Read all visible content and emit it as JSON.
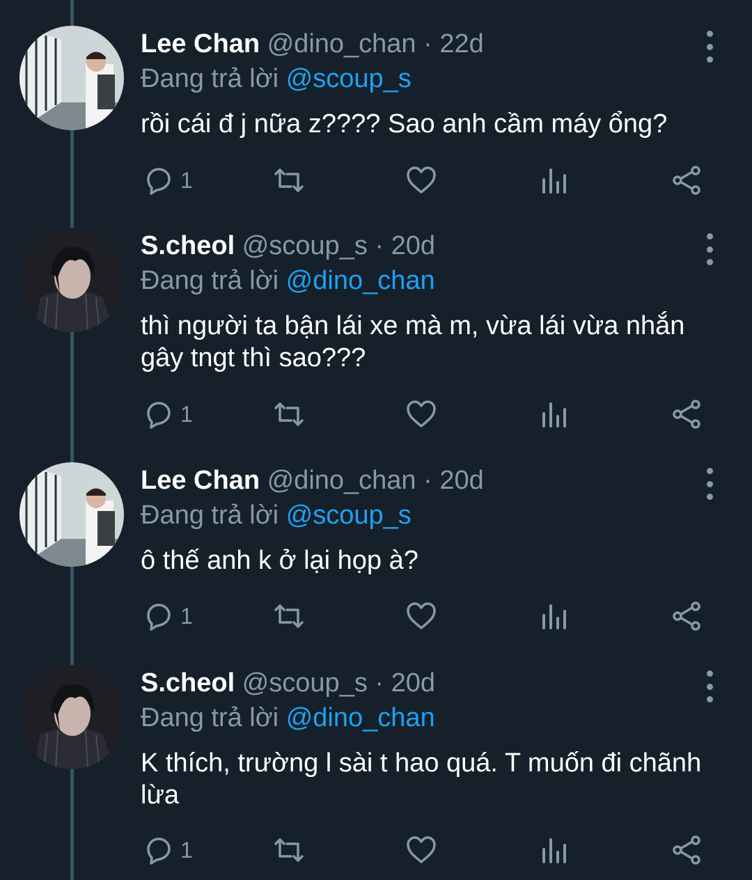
{
  "colors": {
    "background": "#15202b",
    "secondary_text": "#8899a6",
    "mention": "#1da1f2",
    "thread_line": "#3d5466"
  },
  "tweets": [
    {
      "name": "Lee Chan",
      "handle": "@dino_chan",
      "dot": "·",
      "time": "22d",
      "reply_prefix": "Đang trả lời ",
      "reply_to": "@scoup_s",
      "text": "rồi cái đ j nữa z???? Sao anh cầm máy ổng?",
      "reply_count": "1",
      "avatar": "lee-chan-avatar"
    },
    {
      "name": "S.cheol",
      "handle": "@scoup_s",
      "dot": "·",
      "time": "20d",
      "reply_prefix": "Đang trả lời ",
      "reply_to": "@dino_chan",
      "text": "thì người ta bận lái xe mà m, vừa lái vừa nhắn gây tngt thì sao???",
      "reply_count": "1",
      "avatar": "scheol-avatar"
    },
    {
      "name": "Lee Chan",
      "handle": "@dino_chan",
      "dot": "·",
      "time": "20d",
      "reply_prefix": "Đang trả lời ",
      "reply_to": "@scoup_s",
      "text": "ô thế anh k ở lại họp à?",
      "reply_count": "1",
      "avatar": "lee-chan-avatar"
    },
    {
      "name": "S.cheol",
      "handle": "@scoup_s",
      "dot": "·",
      "time": "20d",
      "reply_prefix": "Đang trả lời ",
      "reply_to": "@dino_chan",
      "text": "K thích, trường l sài t hao quá. T muốn đi chãnh lừa",
      "reply_count": "1",
      "avatar": "scheol-avatar"
    }
  ],
  "icons": {
    "reply": "reply-icon",
    "retweet": "retweet-icon",
    "like": "heart-icon",
    "analytics": "analytics-icon",
    "share": "share-icon",
    "more": "more-vertical-icon"
  }
}
